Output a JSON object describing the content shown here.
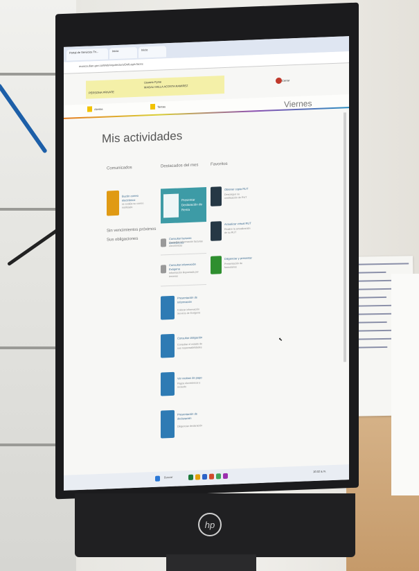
{
  "browser": {
    "tabs": [
      "Portal de Servicios Tri...",
      "Inicio",
      "Inicio"
    ],
    "url": "muisca.dian.gov.co/WebArquitectura/DefLogin.faces"
  },
  "banner": {
    "title": "Usuario Pyme",
    "user": "MAGALI MILLA ACOSTA RAMIREZ",
    "left": "PERSONA PRIVATE",
    "logout": "Cerrar"
  },
  "nav": {
    "items": [
      "Alertas",
      "Tareas"
    ],
    "day": "Viernes"
  },
  "page": {
    "heading": "Mis actividades"
  },
  "columns": {
    "comunicados": {
      "title": "Comunicados",
      "item_label": "Buzón correo electrónico",
      "item_sub": "se evalúa su correo notificado",
      "note1": "Sin vencimientos próximos",
      "note2": "Sus obligaciones"
    },
    "destacados": {
      "title": "Destacados del mes",
      "featured": "Presentar Declaración de Renta",
      "items": [
        {
          "label": "Consultar facturas electrónicas",
          "sub": "Consultar información facturas electrónicas"
        },
        {
          "label": "Consultar información Exógena",
          "sub": "Información Reportada por terceros"
        },
        {
          "label": "Presentación de Información",
          "sub": "Colocar información Servicio de Exógena"
        },
        {
          "label": "Consultar obligación",
          "sub": "Consultar el estado de sus responsabilidades"
        },
        {
          "label": "Ver recibos de pago",
          "sub": "Pagos electrónicos y recaudo"
        },
        {
          "label": "Presentación de declaración",
          "sub": "Diligenciar declaración"
        }
      ]
    },
    "favoritos": {
      "title": "Favoritos",
      "items": [
        {
          "label": "Obtener copia RUT",
          "sub": "Descargue su certificación de RUT"
        },
        {
          "label": "Actualizar virtual RUT",
          "sub": "Realice la actualización de su RUT"
        },
        {
          "label": "Diligenciar y presentar",
          "sub": "Presentación de formularios"
        }
      ]
    }
  },
  "taskbar": {
    "search": "Buscar",
    "time": "10:32 a.m."
  },
  "monitor": {
    "brand": "hp"
  }
}
